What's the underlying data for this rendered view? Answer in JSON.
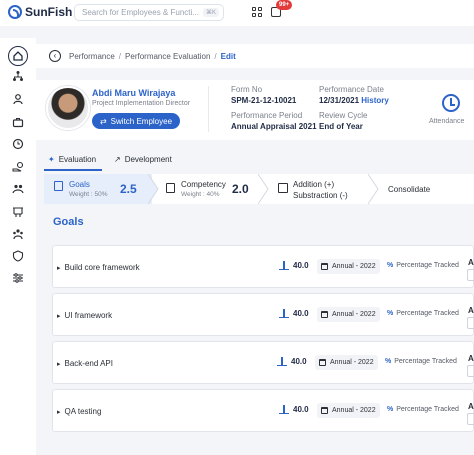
{
  "app": {
    "name": "SunFish"
  },
  "search": {
    "placeholder": "Search for Employees & Functi...",
    "shortcut": "⌘K"
  },
  "notifications": {
    "badge": "99+"
  },
  "sidebar": {
    "items": [
      {
        "icon": "home-icon",
        "active": true
      },
      {
        "icon": "org-chart-icon"
      },
      {
        "icon": "person-icon"
      },
      {
        "icon": "briefcase-icon"
      },
      {
        "icon": "clock-icon"
      },
      {
        "icon": "money-icon"
      },
      {
        "icon": "people-hand-icon"
      },
      {
        "icon": "training-icon"
      },
      {
        "icon": "team-icon"
      },
      {
        "icon": "shield-icon"
      },
      {
        "icon": "sliders-icon"
      }
    ]
  },
  "breadcrumb": {
    "items": [
      "Performance",
      "Performance Evaluation"
    ],
    "current": "Edit"
  },
  "employee": {
    "name": "Abdi Maru Wirajaya",
    "role": "Project Implementation Director",
    "switch_label": "Switch Employee"
  },
  "form": {
    "form_no_label": "Form No",
    "form_no": "SPM-21-12-10021",
    "performance_date_label": "Performance Date",
    "performance_date": "12/31/2021",
    "history_label": "History",
    "period_label": "Performance Period",
    "period": "Annual Appraisal 2021",
    "review_label": "Review Cycle",
    "review": "End of Year",
    "attendance_label": "Attendance"
  },
  "tabs": [
    {
      "label": "Evaluation",
      "active": true
    },
    {
      "label": "Development"
    }
  ],
  "steps": [
    {
      "label": "Goals",
      "weight": "Weight : 50%",
      "score": "2.5",
      "active": true
    },
    {
      "label": "Competency",
      "weight": "Weight : 40%",
      "score": "2.0"
    },
    {
      "label": "Addition (+)",
      "label2": "Substraction (-)"
    },
    {
      "label": "Consolidate"
    }
  ],
  "goals": {
    "title": "Goals",
    "items": [
      {
        "name": "Build core framework",
        "weight": "40.0",
        "period": "Annual - 2022",
        "tracking": "Percentage Tracked"
      },
      {
        "name": "UI framework",
        "weight": "40.0",
        "period": "Annual - 2022",
        "tracking": "Percentage Tracked"
      },
      {
        "name": "Back-end API",
        "weight": "40.0",
        "period": "Annual - 2022",
        "tracking": "Percentage Tracked"
      },
      {
        "name": "QA testing",
        "weight": "40.0",
        "period": "Annual - 2022",
        "tracking": "Percentage Tracked"
      }
    ],
    "cut_label": "A"
  },
  "colors": {
    "accent": "#2c63c9",
    "badge": "#e23b3b",
    "active_step": "#e6eefb"
  }
}
